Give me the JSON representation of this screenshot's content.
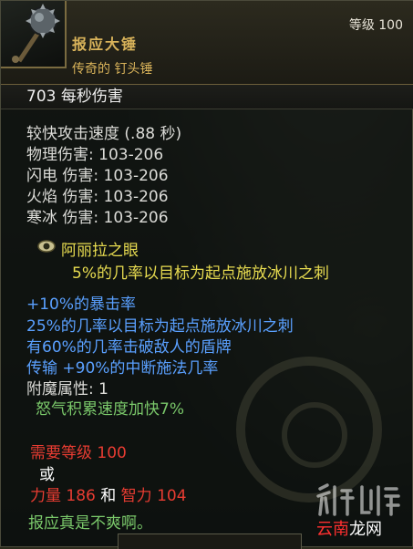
{
  "item": {
    "name": "报应大锤",
    "type": "传奇的 钉头锤",
    "level": "等级 100",
    "dps": "703  每秒伤害"
  },
  "stats": [
    "较快攻击速度 (.88 秒)",
    "物理伤害: 103-206",
    "闪电 伤害: 103-206",
    "火焰 伤害: 103-206",
    "寒冰 伤害: 103-206"
  ],
  "gem": {
    "name": "阿丽拉之眼",
    "effect": "5%的几率以目标为起点施放冰川之刺"
  },
  "magic_props": [
    "+10%的暴击率",
    "25%的几率以目标为起点施放冰川之刺",
    "有60%的几率击破敌人的盾牌",
    "传输 +90%的中断施法几率"
  ],
  "enchant": {
    "label": "附魔属性: 1",
    "value": "怒气积累速度加快7%"
  },
  "requirements": {
    "level": "需要等级 100",
    "or": "或",
    "str": "力量 186",
    "and": "和",
    "int": "智力 104"
  },
  "flavor": "报应真是不爽啊。",
  "watermark": {
    "logo": "云南龙网",
    "cn_prefix": "云南",
    "cn_suffix": "龙网"
  },
  "colors": {
    "gold": "#d9b35a",
    "white": "#ffffff",
    "gray": "#dcdcd8",
    "yellow": "#e8dc50",
    "blue": "#5aa0ff",
    "green": "#7ac86a",
    "red": "#e83c32"
  }
}
